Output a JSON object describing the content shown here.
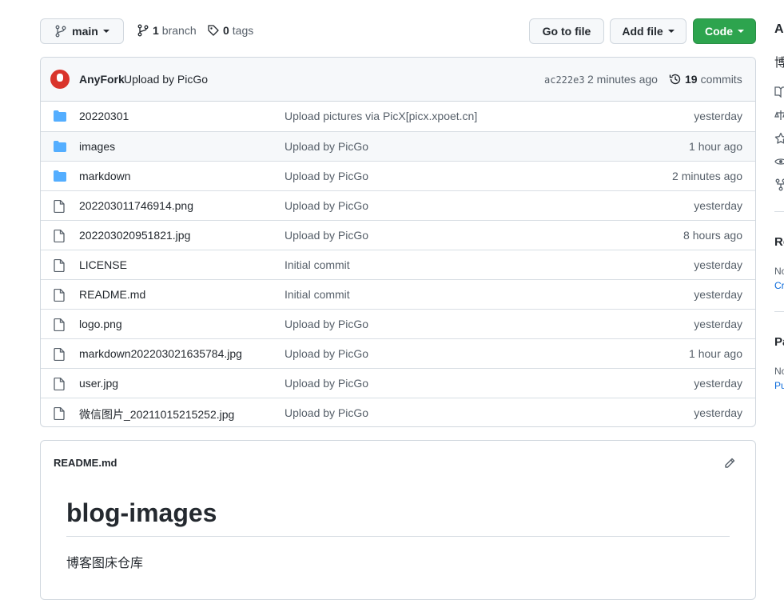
{
  "toolbar": {
    "branch_name": "main",
    "branches_count": "1",
    "branches_label": "branch",
    "tags_count": "0",
    "tags_label": "tags",
    "go_to_file": "Go to file",
    "add_file": "Add file",
    "code": "Code"
  },
  "commit": {
    "author": "AnyFork",
    "message": "Upload by PicGo",
    "sha": "ac222e3",
    "time": "2 minutes ago",
    "count": "19",
    "count_label": "commits"
  },
  "files": [
    {
      "type": "folder",
      "name": "20220301",
      "message": "Upload pictures via PicX[picx.xpoet.cn]",
      "age": "yesterday"
    },
    {
      "type": "folder",
      "name": "images",
      "message": "Upload by PicGo",
      "age": "1 hour ago"
    },
    {
      "type": "folder",
      "name": "markdown",
      "message": "Upload by PicGo",
      "age": "2 minutes ago"
    },
    {
      "type": "file",
      "name": "202203011746914.png",
      "message": "Upload by PicGo",
      "age": "yesterday"
    },
    {
      "type": "file",
      "name": "202203020951821.jpg",
      "message": "Upload by PicGo",
      "age": "8 hours ago"
    },
    {
      "type": "file",
      "name": "LICENSE",
      "message": "Initial commit",
      "age": "yesterday"
    },
    {
      "type": "file",
      "name": "README.md",
      "message": "Initial commit",
      "age": "yesterday"
    },
    {
      "type": "file",
      "name": "logo.png",
      "message": "Upload by PicGo",
      "age": "yesterday"
    },
    {
      "type": "file",
      "name": "markdown202203021635784.jpg",
      "message": "Upload by PicGo",
      "age": "1 hour ago"
    },
    {
      "type": "file",
      "name": "user.jpg",
      "message": "Upload by PicGo",
      "age": "yesterday"
    },
    {
      "type": "file",
      "name": "微信图片_20211015215252.jpg",
      "message": "Upload by PicGo",
      "age": "yesterday"
    }
  ],
  "readme": {
    "filename": "README.md",
    "heading": "blog-images",
    "description": "博客图床仓库"
  },
  "sidebar": {
    "about_heading": "A",
    "about_text": "博",
    "releases_heading": "Re",
    "releases_line1": "No",
    "releases_line2": "Cr",
    "packages_heading": "Pa",
    "packages_line1": "No",
    "packages_line2": "Pu"
  },
  "colors": {
    "primary_button": "#2da44e",
    "folder_icon": "#54aeff",
    "link": "#0969da"
  }
}
